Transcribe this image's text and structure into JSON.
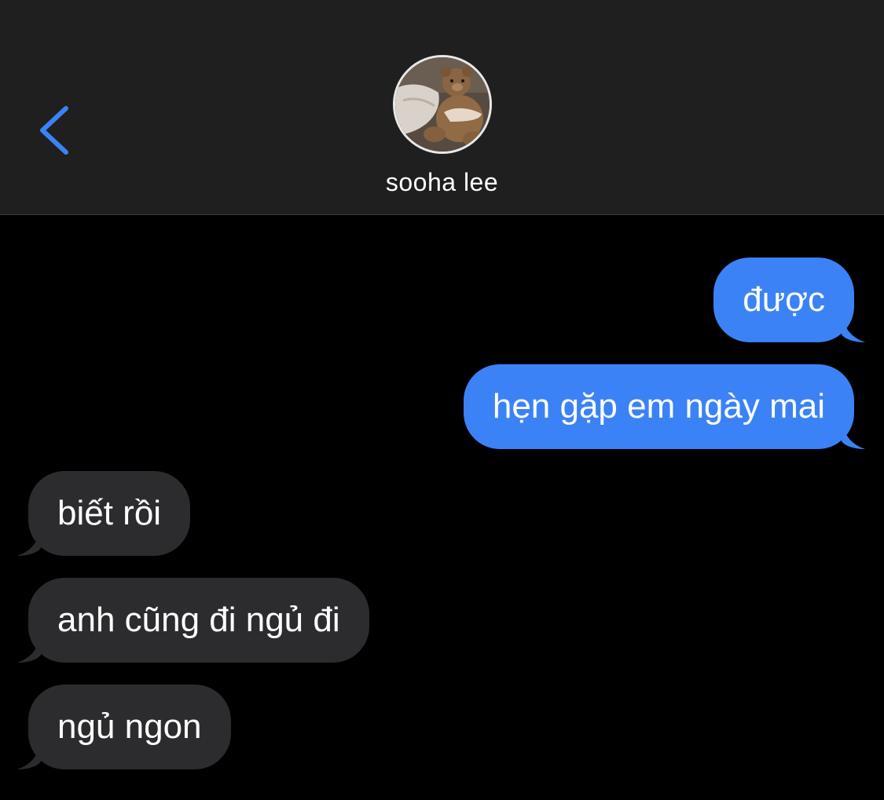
{
  "header": {
    "contact_name": "sooha lee",
    "avatar_icon": "teddy-bear-photo",
    "back_icon": "chevron-left-icon"
  },
  "colors": {
    "background": "#000000",
    "header_bg": "#1f1f20",
    "sent_bubble": "#3b82f6",
    "received_bubble": "#2c2c2e",
    "accent": "#3b82f6"
  },
  "messages": [
    {
      "direction": "sent",
      "text": "được"
    },
    {
      "direction": "sent",
      "text": "hẹn gặp em ngày mai"
    },
    {
      "direction": "received",
      "text": "biết rồi"
    },
    {
      "direction": "received",
      "text": "anh cũng đi ngủ đi"
    },
    {
      "direction": "received",
      "text": "ngủ ngon"
    }
  ]
}
